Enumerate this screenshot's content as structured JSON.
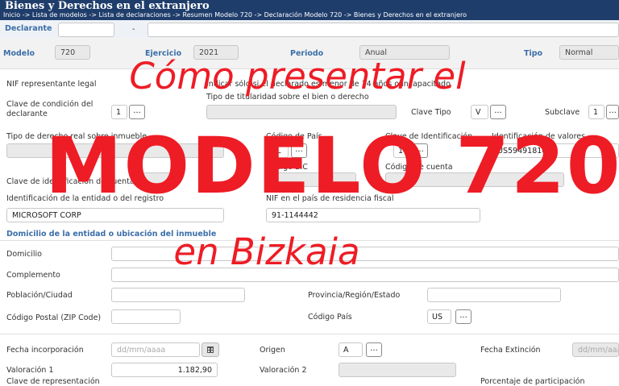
{
  "header": {
    "title": "Bienes y Derechos en el extranjero",
    "breadcrumb": "Inicio -> Lista de modelos -> Lista de declaraciones -> Resumen Modelo 720 -> Declaración Modelo 720 -> Bienes y Derechos en el extranjero"
  },
  "declarante": {
    "label": "Declarante",
    "dash": "-"
  },
  "top": {
    "modelo_label": "Modelo",
    "modelo_value": "720",
    "ejercicio_label": "Ejercicio",
    "ejercicio_value": "2021",
    "periodo_label": "Periodo",
    "periodo_value": "Anual",
    "tipo_label": "Tipo",
    "tipo_value": "Normal"
  },
  "form": {
    "nif_rep_label": "NIF representante legal",
    "indicar_label": "Indicar sólo si el declarado es menor de 14 años o incapacitado",
    "clave_condicion_label_1": "Clave de condición del",
    "clave_condicion_label_2": "declarante",
    "clave_condicion_value": "1",
    "tipo_titularidad_label": "Tipo de titularidad sobre el bien o derecho",
    "clave_tipo_label": "Clave Tipo",
    "clave_tipo_value": "V",
    "subclave_label": "Subclave",
    "subclave_value": "1",
    "tipo_derecho_label": "Tipo de derecho real sobre inmueble",
    "codigo_pais_label": "Código de País",
    "codigo_pais_value": "NL",
    "clave_identificacion_label": "Clave de Identificación",
    "clave_identificacion_value": "1",
    "identificacion_valores_label": "Identificación de valores",
    "identificacion_valores_value": "US5949181045",
    "clave_identificacion_cuenta_label": "Clave de identificación de cuenta",
    "codigo_bic_label": "Código BIC",
    "codigo_cuenta_label": "Código de cuenta",
    "identificacion_entidad_label": "Identificación de la entidad o del registro",
    "identificacion_entidad_value": "MICROSOFT CORP",
    "nif_pais_label": "NIF en el país de residencia fiscal",
    "nif_pais_value": "91-1144442",
    "dots": "..."
  },
  "domicilio": {
    "section_title": "Domicilio de la entidad o ubicación del inmueble",
    "domicilio_label": "Domicilio",
    "complemento_label": "Complemento",
    "poblacion_label": "Población/Ciudad",
    "provincia_label": "Provincia/Región/Estado",
    "codigo_postal_label": "Código Postal (ZIP Code)",
    "codigo_pais_label": "Código País",
    "codigo_pais_value": "US"
  },
  "valoracion": {
    "fecha_incorporacion_label": "Fecha incorporación",
    "fecha_placeholder": "dd/mm/aaaa",
    "origen_label": "Origen",
    "origen_value": "A",
    "fecha_extincion_label": "Fecha Extinción",
    "valoracion1_label": "Valoración 1",
    "valoracion1_value": "1.182,90",
    "valoracion2_label": "Valoración 2",
    "clave_representacion_label": "Clave de representación",
    "porcentaje_label": "Porcentaje de participación"
  },
  "overlay": {
    "line1": "Cómo presentar el",
    "line2": "MODELO 720",
    "line3": "en Bizkaia"
  },
  "colors": {
    "header": "#1f3d6b",
    "accent": "#3b6ea8",
    "overlay": "#ee1c25"
  }
}
